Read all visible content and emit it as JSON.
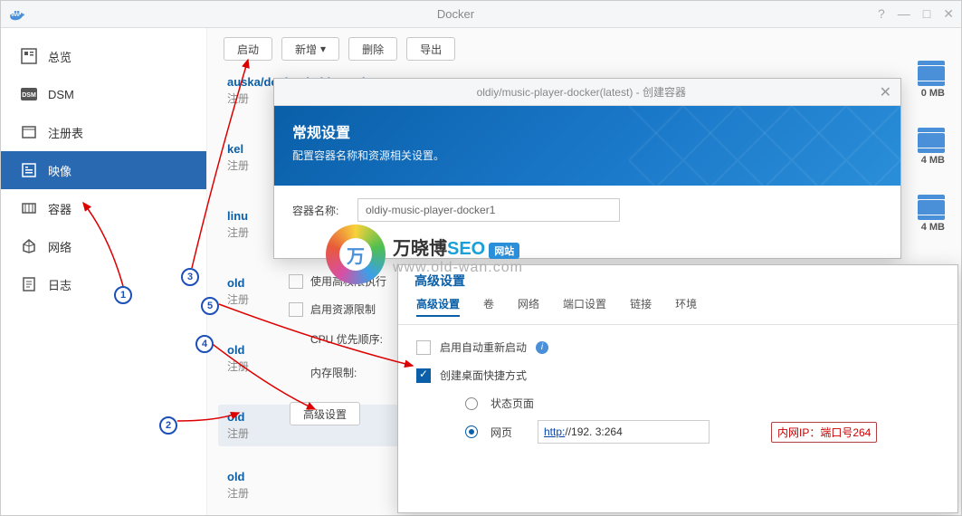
{
  "window": {
    "title": "Docker",
    "help_icon": "?",
    "minimize": "—",
    "maximize": "□",
    "close": "✕"
  },
  "sidebar": {
    "items": [
      {
        "label": "总览"
      },
      {
        "label": "DSM"
      },
      {
        "label": "注册表"
      },
      {
        "label": "映像"
      },
      {
        "label": "容器"
      },
      {
        "label": "网络"
      },
      {
        "label": "日志"
      }
    ]
  },
  "toolbar": {
    "launch": "启动",
    "add": "新增",
    "delete": "删除",
    "export": "导出"
  },
  "images": [
    {
      "title": "auska/docker-baidupcs:latest",
      "sub": "注册",
      "size": "0 MB"
    },
    {
      "title": "kel",
      "sub": "注册",
      "size": "4 MB"
    },
    {
      "title": "linu",
      "sub": "注册",
      "size": "4 MB"
    },
    {
      "title": "old",
      "sub": "注册",
      "size": ""
    },
    {
      "title": "old",
      "sub": "注册",
      "size": ""
    },
    {
      "title": "old",
      "sub": "注册",
      "size": ""
    },
    {
      "title": "old",
      "sub": "注册",
      "size": ""
    }
  ],
  "modal1": {
    "title": "oldiy/music-player-docker(latest) - 创建容器",
    "banner_h": "常规设置",
    "banner_p": "配置容器名称和资源相关设置。",
    "name_label": "容器名称:",
    "name_value": "oldiy-music-player-docker1",
    "priv_label": "使用高权限执行",
    "limit_label": "启用资源限制",
    "cpu_label": "CPU 优先顺序:",
    "mem_label": "内存限制:",
    "adv_btn": "高级设置"
  },
  "modal2": {
    "title": "高级设置",
    "tabs": [
      "高级设置",
      "卷",
      "网络",
      "端口设置",
      "链接",
      "环境"
    ],
    "auto_restart": "启用自动重新启动",
    "shortcut": "创建桌面快捷方式",
    "status_page": "状态页面",
    "web": "网页",
    "url_prefix": "http:",
    "url_value": "//192.            3:264",
    "note": "内网IP：端口号264"
  },
  "watermark": {
    "brand_a": "万晓博",
    "brand_b": "SEO",
    "badge": "网站",
    "url": "www.old-wan.com",
    "logo_char": "万"
  }
}
